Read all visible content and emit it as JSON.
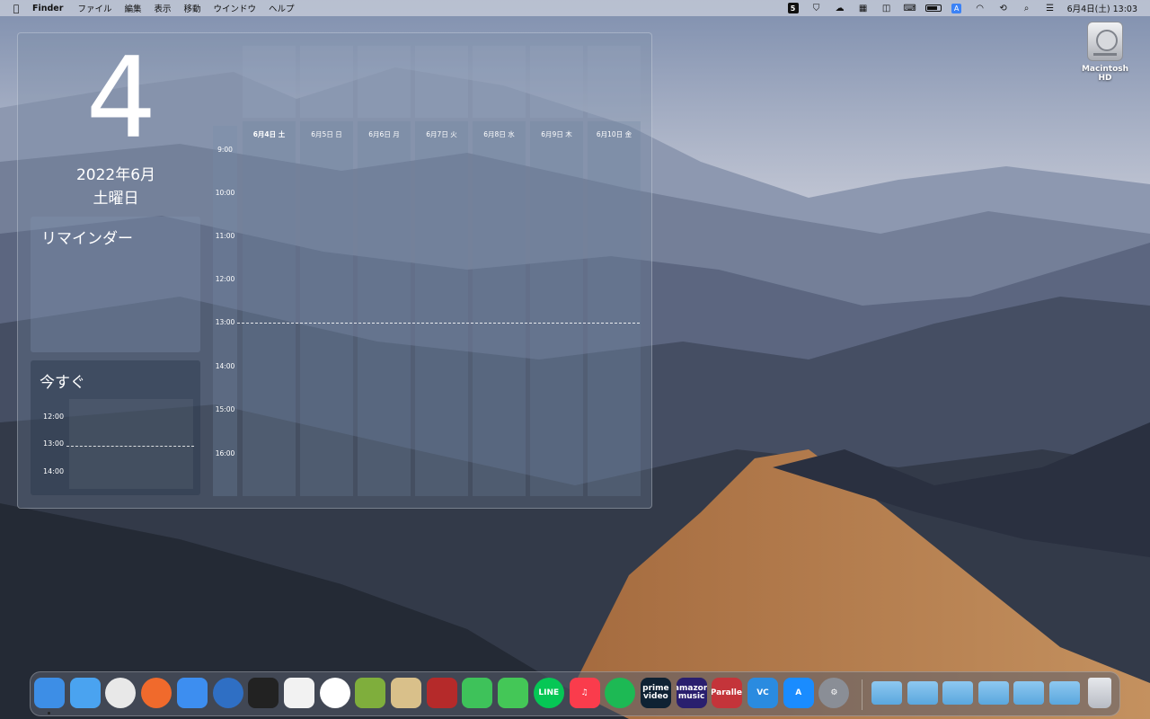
{
  "menubar": {
    "apple_icon": "apple-icon",
    "app_name": "Finder",
    "menus": [
      "ファイル",
      "編集",
      "表示",
      "移動",
      "ウインドウ",
      "ヘルプ"
    ],
    "status_icons": [
      "five-badge-icon",
      "shield-icon",
      "cloud-upload-icon",
      "layout-icon",
      "split-screen-icon",
      "keyboard-icon",
      "battery-icon",
      "input-method-icon",
      "wifi-icon",
      "time-machine-icon",
      "spotlight-search-icon",
      "control-center-icon"
    ],
    "badge_five": "5",
    "badge_input": "A",
    "clock": "6月4日(土) 13:03"
  },
  "desktop": {
    "hd_label": "Macintosh HD"
  },
  "widget": {
    "day": "4",
    "year_month": "2022年6月",
    "weekday": "土曜日",
    "reminder_title": "リマインダー",
    "now_title": "今すぐ",
    "now_hours": [
      "12:00",
      "13:00",
      "14:00"
    ],
    "week_hours": [
      "9:00",
      "10:00",
      "11:00",
      "12:00",
      "13:00",
      "14:00",
      "15:00",
      "16:00"
    ],
    "days": [
      "6月4日 土",
      "6月5日 日",
      "6月6日 月",
      "6月7日 火",
      "6月8日 水",
      "6月9日 木",
      "6月10日 金"
    ],
    "today_index": 0
  },
  "dock": {
    "apps": [
      {
        "name": "finder-icon",
        "color": "#3d8ee6",
        "label": ""
      },
      {
        "name": "safari-icon",
        "color": "#4aa3f0",
        "label": ""
      },
      {
        "name": "chrome-icon",
        "color": "#e8e8e8",
        "label": ""
      },
      {
        "name": "firefox-icon",
        "color": "#f06a2c",
        "label": ""
      },
      {
        "name": "mail-icon",
        "color": "#3d8ef0",
        "label": ""
      },
      {
        "name": "thunderbird-icon",
        "color": "#2f6fc4",
        "label": ""
      },
      {
        "name": "terminal-icon",
        "color": "#222222",
        "label": ""
      },
      {
        "name": "text-document-icon",
        "color": "#f2f2f2",
        "label": ""
      },
      {
        "name": "evernote-icon",
        "color": "#ffffff",
        "label": ""
      },
      {
        "name": "writing-app-icon",
        "color": "#7fae3c",
        "label": ""
      },
      {
        "name": "preview-icon",
        "color": "#d9c08a",
        "label": ""
      },
      {
        "name": "photo-booth-icon",
        "color": "#b52a2a",
        "label": ""
      },
      {
        "name": "facetime-icon",
        "color": "#3ec25a",
        "label": ""
      },
      {
        "name": "messages-icon",
        "color": "#44c757",
        "label": ""
      },
      {
        "name": "line-icon",
        "color": "#06c755",
        "label": "LINE"
      },
      {
        "name": "music-icon",
        "color": "#fa3c4c",
        "label": "♫"
      },
      {
        "name": "spotify-icon",
        "color": "#1db954",
        "label": ""
      },
      {
        "name": "prime-video-icon",
        "color": "#0f2233",
        "label": "prime video"
      },
      {
        "name": "amazon-music-icon",
        "color": "#2a1f6e",
        "label": "amazon music"
      },
      {
        "name": "parallels-icon",
        "color": "#c4343a",
        "label": "||Parallels"
      },
      {
        "name": "vs-code-icon",
        "color": "#2a8be0",
        "label": "VC"
      },
      {
        "name": "app-store-icon",
        "color": "#1a8cff",
        "label": "A"
      },
      {
        "name": "system-preferences-icon",
        "color": "#8a8e96",
        "label": "⚙"
      }
    ],
    "folders": [
      "applications-folder-icon",
      "app-store-folder-icon",
      "pictures-folder-icon",
      "cloud-folder-icon",
      "dropbox-folder-icon",
      "downloads-folder-icon"
    ],
    "trash": "trash-icon"
  }
}
